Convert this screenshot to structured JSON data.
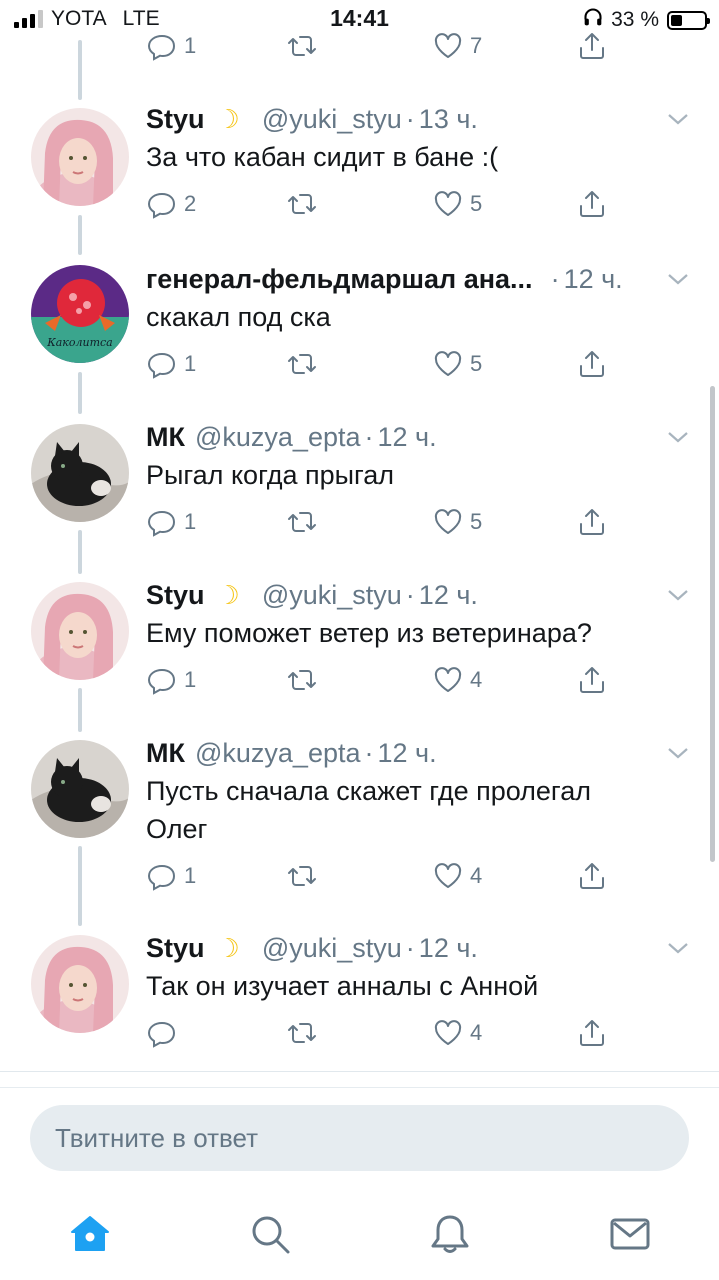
{
  "status_bar": {
    "carrier": "YOTA",
    "network": "LTE",
    "time": "14:41",
    "battery": "33 %",
    "battery_level": 0.33,
    "signal_bars_filled": 3,
    "signal_bars_total": 4
  },
  "top_partial_actions": {
    "reply_count": "1",
    "like_count": "7"
  },
  "tweets": [
    {
      "name": "Styu",
      "emoji": "☽",
      "handle": "@yuki_styu",
      "time": "13 ч.",
      "text": "За что кабан сидит в бане :(",
      "replies": "2",
      "retweets": "",
      "likes": "5"
    },
    {
      "name": "генерал-фельдмаршал ана...",
      "emoji": "",
      "handle": "",
      "time": "12 ч.",
      "text": "скакал под ска",
      "replies": "1",
      "retweets": "",
      "likes": "5"
    },
    {
      "name": "МК",
      "emoji": "",
      "handle": "@kuzya_epta",
      "time": "12 ч.",
      "text": "Рыгал когда прыгал",
      "replies": "1",
      "retweets": "",
      "likes": "5"
    },
    {
      "name": "Styu",
      "emoji": "☽",
      "handle": "@yuki_styu",
      "time": "12 ч.",
      "text": "Ему поможет ветер из ветеринара?",
      "replies": "1",
      "retweets": "",
      "likes": "4"
    },
    {
      "name": "МК",
      "emoji": "",
      "handle": "@kuzya_epta",
      "time": "12 ч.",
      "text": "Пусть сначала скажет где пролегал Олег",
      "replies": "1",
      "retweets": "",
      "likes": "4"
    },
    {
      "name": "Styu",
      "emoji": "☽",
      "handle": "@yuki_styu",
      "time": "12 ч.",
      "text": "Так он изучает анналы с Анной",
      "replies": "",
      "retweets": "",
      "likes": "4"
    }
  ],
  "reply": {
    "placeholder": "Твитните в ответ"
  },
  "tabbar": {
    "items": [
      {
        "icon": "home-icon",
        "active": true
      },
      {
        "icon": "search-icon",
        "active": false
      },
      {
        "icon": "bell-icon",
        "active": false
      },
      {
        "icon": "mail-icon",
        "active": false
      }
    ]
  },
  "colors": {
    "accent": "#1da1f2",
    "secondary_text": "#657786",
    "thread_line": "#ccd6dd",
    "reply_bg": "#e6ecf0"
  }
}
